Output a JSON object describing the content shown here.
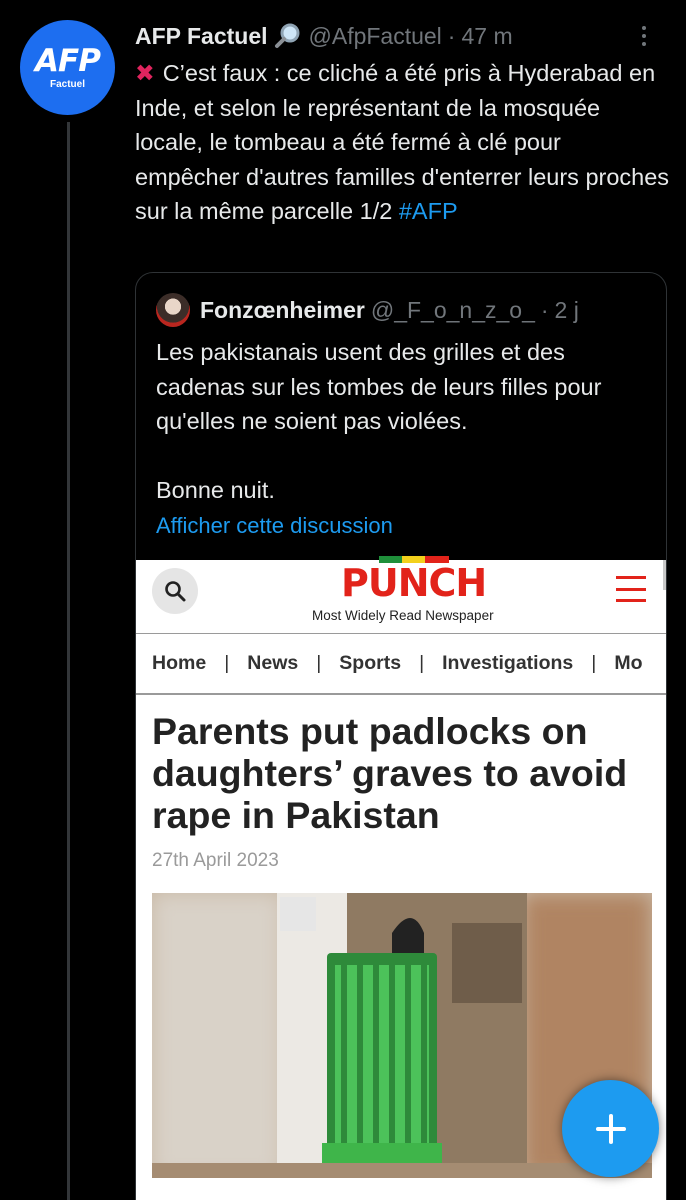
{
  "tweet": {
    "avatar_logo": "AFP",
    "avatar_sub": "Factuel",
    "author_name": "AFP Factuel",
    "handle": "@AfpFactuel",
    "separator": "·",
    "time": "47 m",
    "body_text": "C’est faux : ce cliché a été pris à Hyderabad en Inde, et selon le représentant de la mosquée locale, le tombeau a été fermé à clé pour empêcher d'autres familles d'enterrer leurs proches sur la même parcelle 1/2 ",
    "hashtag": "#AFP",
    "x_mark": "✖"
  },
  "quote": {
    "author_name": "Fonzœnheimer",
    "handle": "@_F_o_n_z_o_",
    "separator": "·",
    "time": "2 j",
    "body_text": "Les pakistanais usent des grilles et des cadenas sur les tombes de leurs filles pour qu'elles ne soient pas violées.\n\nBonne nuit.",
    "show_thread_link": "Afficher cette discussion"
  },
  "screenshot": {
    "logo": "PUNCH",
    "tagline": "Most Widely Read Newspaper",
    "nav": [
      "Home",
      "News",
      "Sports",
      "Investigations",
      "Mo"
    ],
    "nav_separator": "|",
    "headline": "Parents put padlocks on daughters’ graves to avoid rape in Pakistan",
    "date": "27th April 2023"
  },
  "colors": {
    "accent": "#1d9bf0",
    "background": "#000000",
    "afp_blue": "#1d6ef0",
    "punch_red": "#e2231a",
    "grate_green": "#3fb54a"
  },
  "icons": {
    "fab": "compose-plus-icon",
    "search": "search-icon",
    "menu": "hamburger-menu-icon",
    "more": "more-vertical-icon"
  }
}
